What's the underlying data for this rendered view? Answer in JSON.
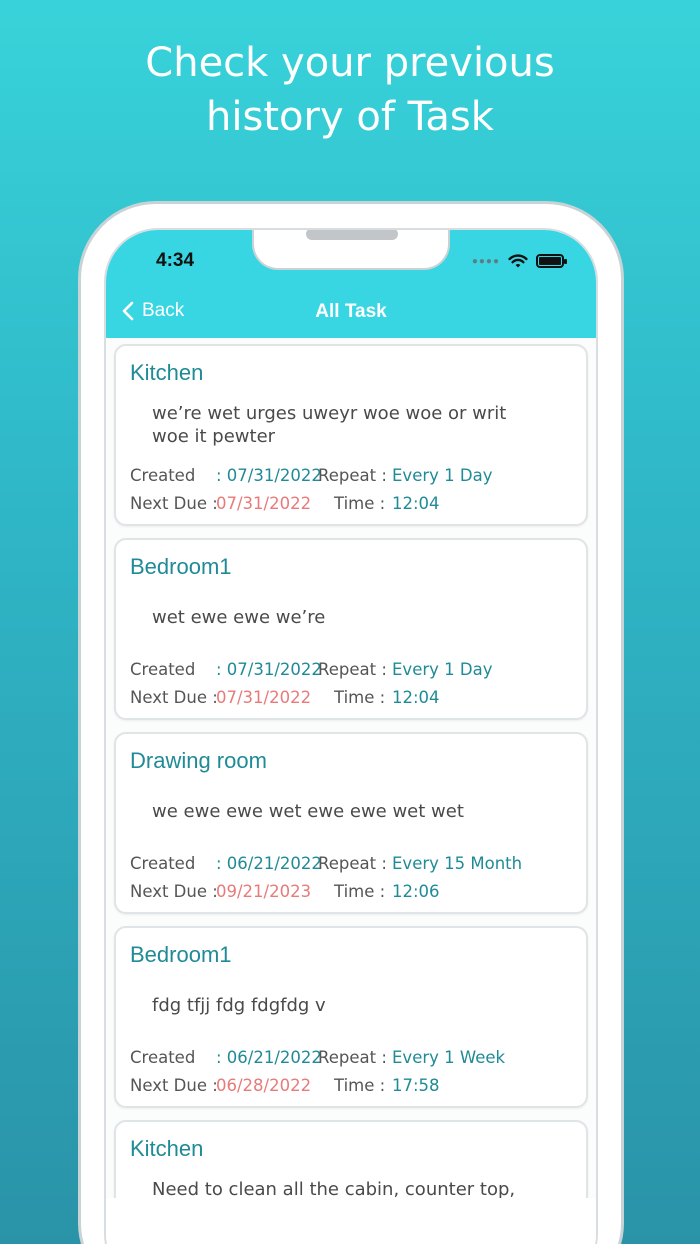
{
  "promo": {
    "headline_line1": "Check your previous",
    "headline_line2": "history of Task"
  },
  "status_bar": {
    "time": "4:34",
    "icons": [
      "signal-dots-icon",
      "wifi-icon",
      "battery-icon"
    ]
  },
  "nav": {
    "back_label": "Back",
    "title": "All Task",
    "back_icon": "chevron-left-icon"
  },
  "labels": {
    "created": "Created",
    "next_due": "Next Due :",
    "repeat": "Repeat :",
    "time": "Time :"
  },
  "colors": {
    "accent": "#38d6e2",
    "title_teal": "#1f8b96",
    "due_red": "#e87a7a"
  },
  "tasks": [
    {
      "title": "Kitchen",
      "description": "we’re wet urges uweyr woe woe or writ woe it pewter",
      "created": ": 07/31/2022",
      "repeat": "Every 1 Day",
      "next_due": "07/31/2022",
      "time": "12:04"
    },
    {
      "title": "Bedroom1",
      "description": "wet ewe ewe we’re",
      "created": ": 07/31/2022",
      "repeat": "Every 1 Day",
      "next_due": "07/31/2022",
      "time": "12:04"
    },
    {
      "title": "Drawing room",
      "description": "we ewe ewe wet ewe ewe wet wet",
      "created": ": 06/21/2022",
      "repeat": "Every 15 Month",
      "next_due": "09/21/2023",
      "time": "12:06"
    },
    {
      "title": "Bedroom1",
      "description": "fdg tfjj fdg fdgfdg v",
      "created": ": 06/21/2022",
      "repeat": "Every 1 Week",
      "next_due": "06/28/2022",
      "time": "17:58"
    },
    {
      "title": "Kitchen",
      "description": "Need to clean all the cabin, counter top, gas"
    }
  ]
}
